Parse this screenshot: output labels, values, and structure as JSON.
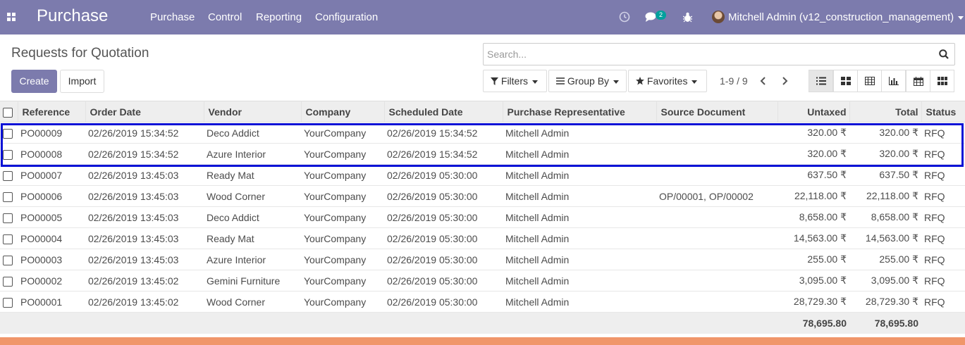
{
  "navbar": {
    "app_name": "Purchase",
    "menu": [
      "Purchase",
      "Control",
      "Reporting",
      "Configuration"
    ],
    "messages_count": "2",
    "user": "Mitchell Admin (v12_construction_management)",
    "bg_color": "#7c7bad"
  },
  "control_panel": {
    "title": "Requests for Quotation",
    "create_label": "Create",
    "import_label": "Import",
    "search_placeholder": "Search...",
    "filters_label": "Filters",
    "group_by_label": "Group By",
    "favorites_label": "Favorites",
    "pager": "1-9 / 9",
    "views": [
      "list-icon",
      "kanban-icon",
      "pivot-icon",
      "graph-icon",
      "calendar-icon",
      "grid-icon"
    ],
    "active_view": "list-icon"
  },
  "table": {
    "columns": [
      "Reference",
      "Order Date",
      "Vendor",
      "Company",
      "Scheduled Date",
      "Purchase Representative",
      "Source Document",
      "Untaxed",
      "Total",
      "Status"
    ],
    "rows": [
      [
        "PO00009",
        "02/26/2019 15:34:52",
        "Deco Addict",
        "YourCompany",
        "02/26/2019 15:34:52",
        "Mitchell Admin",
        "",
        "320.00 ₹",
        "320.00 ₹",
        "RFQ"
      ],
      [
        "PO00008",
        "02/26/2019 15:34:52",
        "Azure Interior",
        "YourCompany",
        "02/26/2019 15:34:52",
        "Mitchell Admin",
        "",
        "320.00 ₹",
        "320.00 ₹",
        "RFQ"
      ],
      [
        "PO00007",
        "02/26/2019 13:45:03",
        "Ready Mat",
        "YourCompany",
        "02/26/2019 05:30:00",
        "Mitchell Admin",
        "",
        "637.50 ₹",
        "637.50 ₹",
        "RFQ"
      ],
      [
        "PO00006",
        "02/26/2019 13:45:03",
        "Wood Corner",
        "YourCompany",
        "02/26/2019 05:30:00",
        "Mitchell Admin",
        "OP/00001, OP/00002",
        "22,118.00 ₹",
        "22,118.00 ₹",
        "RFQ"
      ],
      [
        "PO00005",
        "02/26/2019 13:45:03",
        "Deco Addict",
        "YourCompany",
        "02/26/2019 05:30:00",
        "Mitchell Admin",
        "",
        "8,658.00 ₹",
        "8,658.00 ₹",
        "RFQ"
      ],
      [
        "PO00004",
        "02/26/2019 13:45:03",
        "Ready Mat",
        "YourCompany",
        "02/26/2019 05:30:00",
        "Mitchell Admin",
        "",
        "14,563.00 ₹",
        "14,563.00 ₹",
        "RFQ"
      ],
      [
        "PO00003",
        "02/26/2019 13:45:03",
        "Azure Interior",
        "YourCompany",
        "02/26/2019 05:30:00",
        "Mitchell Admin",
        "",
        "255.00 ₹",
        "255.00 ₹",
        "RFQ"
      ],
      [
        "PO00002",
        "02/26/2019 13:45:02",
        "Gemini Furniture",
        "YourCompany",
        "02/26/2019 05:30:00",
        "Mitchell Admin",
        "",
        "3,095.00 ₹",
        "3,095.00 ₹",
        "RFQ"
      ],
      [
        "PO00001",
        "02/26/2019 13:45:02",
        "Wood Corner",
        "YourCompany",
        "02/26/2019 05:30:00",
        "Mitchell Admin",
        "",
        "28,729.30 ₹",
        "28,729.30 ₹",
        "RFQ"
      ]
    ],
    "totals": {
      "untaxed": "78,695.80",
      "total": "78,695.80"
    },
    "highlight_color": "#0a12d6"
  }
}
